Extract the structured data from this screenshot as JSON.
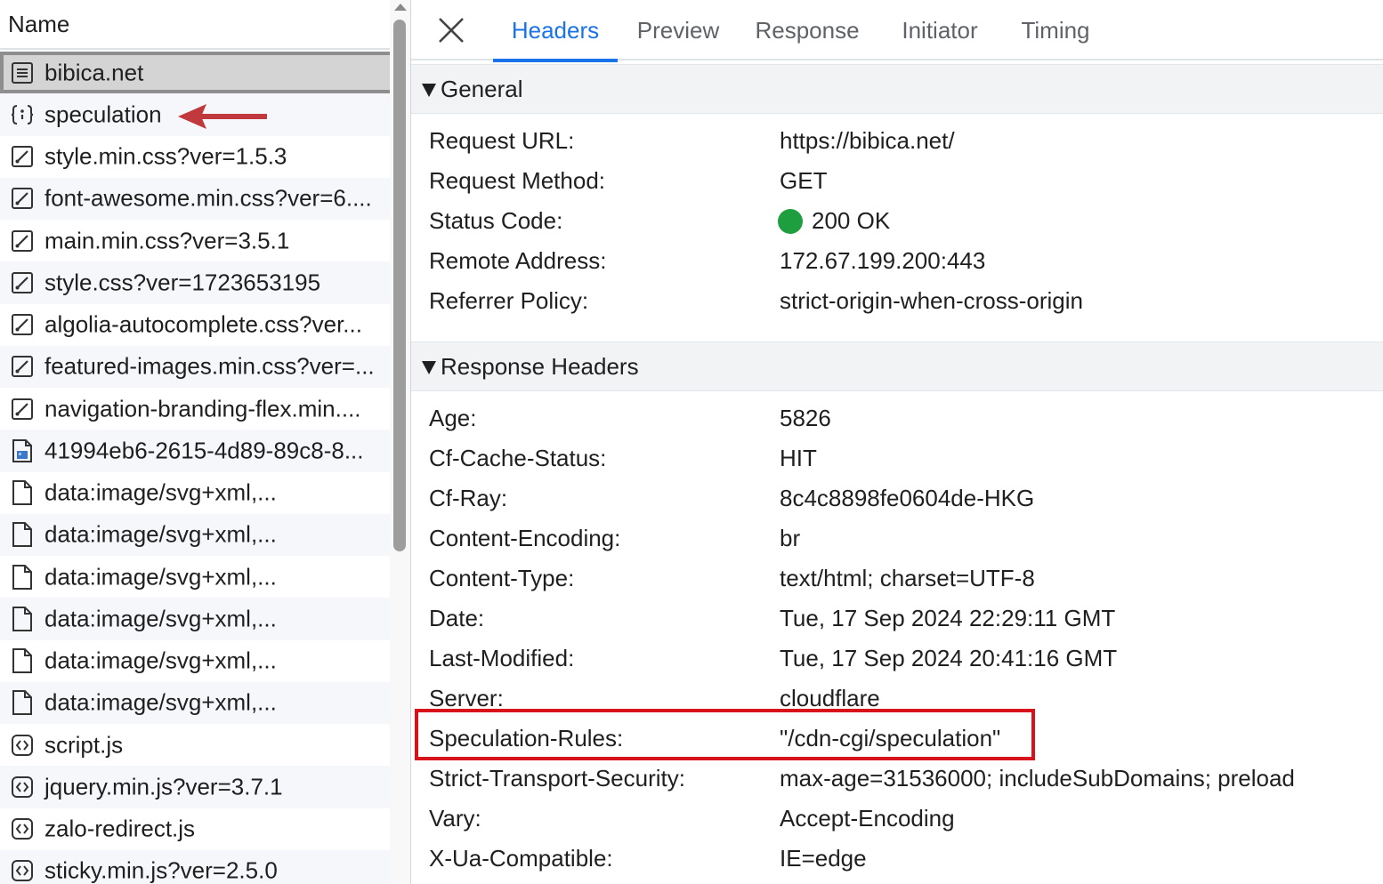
{
  "left": {
    "header": "Name",
    "requests": [
      {
        "label": "bibica.net",
        "icon": "document-icon",
        "selected": true
      },
      {
        "label": "speculation",
        "icon": "speculation-rules-icon"
      },
      {
        "label": "style.min.css?ver=1.5.3",
        "icon": "stylesheet-icon"
      },
      {
        "label": "font-awesome.min.css?ver=6....",
        "icon": "stylesheet-icon"
      },
      {
        "label": "main.min.css?ver=3.5.1",
        "icon": "stylesheet-icon"
      },
      {
        "label": "style.css?ver=1723653195",
        "icon": "stylesheet-icon"
      },
      {
        "label": "algolia-autocomplete.css?ver...",
        "icon": "stylesheet-icon"
      },
      {
        "label": "featured-images.min.css?ver=...",
        "icon": "stylesheet-icon"
      },
      {
        "label": "navigation-branding-flex.min....",
        "icon": "stylesheet-icon"
      },
      {
        "label": "41994eb6-2615-4d89-89c8-8...",
        "icon": "image-file-icon"
      },
      {
        "label": "data:image/svg+xml,...",
        "icon": "file-icon"
      },
      {
        "label": "data:image/svg+xml,...",
        "icon": "file-icon"
      },
      {
        "label": "data:image/svg+xml,...",
        "icon": "file-icon"
      },
      {
        "label": "data:image/svg+xml,...",
        "icon": "file-icon"
      },
      {
        "label": "data:image/svg+xml,...",
        "icon": "file-icon"
      },
      {
        "label": "data:image/svg+xml,...",
        "icon": "file-icon"
      },
      {
        "label": "script.js",
        "icon": "script-icon"
      },
      {
        "label": "jquery.min.js?ver=3.7.1",
        "icon": "script-icon"
      },
      {
        "label": "zalo-redirect.js",
        "icon": "script-icon"
      },
      {
        "label": "sticky.min.js?ver=2.5.0",
        "icon": "script-icon"
      }
    ]
  },
  "tabs": [
    {
      "label": "Headers",
      "active": true
    },
    {
      "label": "Preview"
    },
    {
      "label": "Response"
    },
    {
      "label": "Initiator"
    },
    {
      "label": "Timing"
    }
  ],
  "general": {
    "title": "General",
    "rows": [
      {
        "key": "Request URL:",
        "value": "https://bibica.net/"
      },
      {
        "key": "Request Method:",
        "value": "GET"
      },
      {
        "key": "Status Code:",
        "value": "200 OK"
      },
      {
        "key": "Remote Address:",
        "value": "172.67.199.200:443"
      },
      {
        "key": "Referrer Policy:",
        "value": "strict-origin-when-cross-origin"
      }
    ]
  },
  "response_headers": {
    "title": "Response Headers",
    "rows": [
      {
        "key": "Age:",
        "value": "5826"
      },
      {
        "key": "Cf-Cache-Status:",
        "value": "HIT"
      },
      {
        "key": "Cf-Ray:",
        "value": "8c4c8898fe0604de-HKG"
      },
      {
        "key": "Content-Encoding:",
        "value": "br"
      },
      {
        "key": "Content-Type:",
        "value": "text/html; charset=UTF-8"
      },
      {
        "key": "Date:",
        "value": "Tue, 17 Sep 2024 22:29:11 GMT"
      },
      {
        "key": "Last-Modified:",
        "value": "Tue, 17 Sep 2024 20:41:16 GMT"
      },
      {
        "key": "Server:",
        "value": "cloudflare"
      },
      {
        "key": "Speculation-Rules:",
        "value": "\"/cdn-cgi/speculation\""
      },
      {
        "key": "Strict-Transport-Security:",
        "value": "max-age=31536000; includeSubDomains; preload"
      },
      {
        "key": "Vary:",
        "value": "Accept-Encoding"
      },
      {
        "key": "X-Ua-Compatible:",
        "value": "IE=edge"
      }
    ]
  },
  "colors": {
    "accent": "#1a73e8",
    "status_ok": "#1e9e3e",
    "highlight": "#d8121b",
    "arrow": "#c0393d"
  }
}
